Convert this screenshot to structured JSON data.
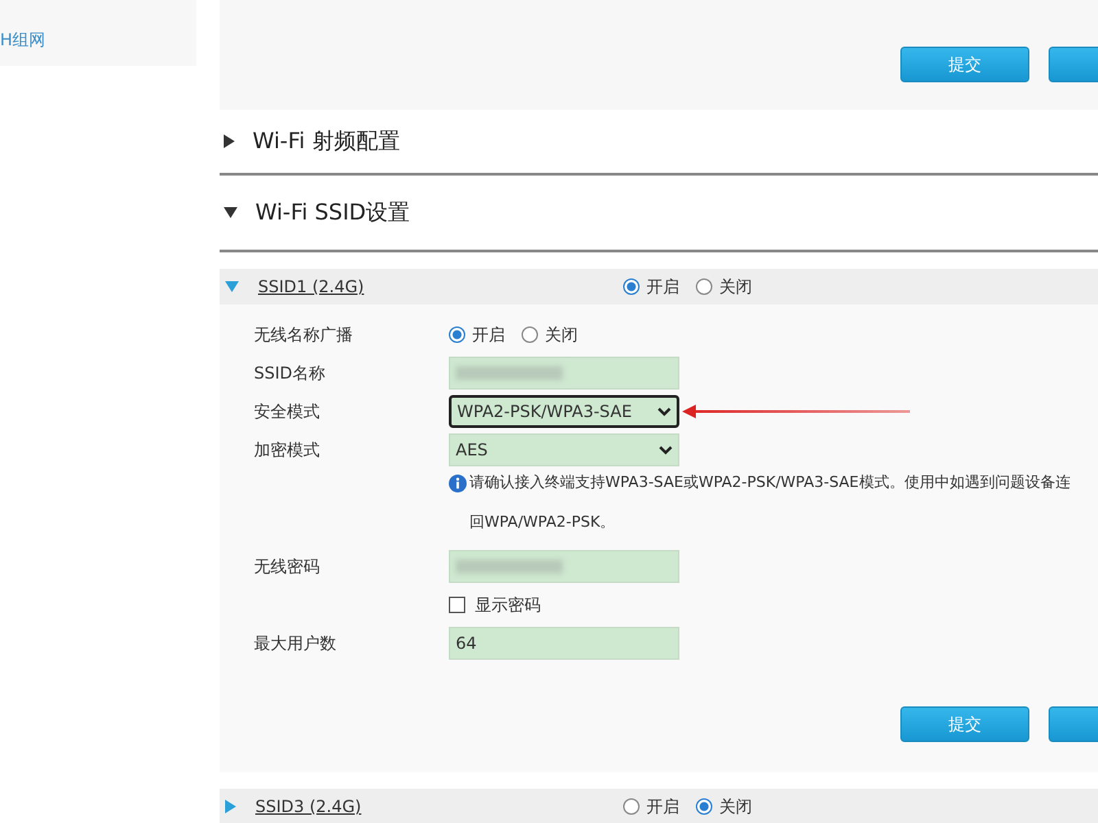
{
  "sidebar": {
    "items": [
      {
        "label": "H组网"
      }
    ]
  },
  "top_buttons": [
    {
      "kind": "submit",
      "label": "提交"
    },
    {
      "kind": "blank"
    }
  ],
  "sections": [
    {
      "title": "Wi-Fi 射频配置",
      "expanded": false
    },
    {
      "title": "Wi-Fi SSID设置",
      "expanded": true
    }
  ],
  "ssids": [
    {
      "name": "SSID1 (2.4G)",
      "expanded": true,
      "options": [
        {
          "label": "开启",
          "selected": true
        },
        {
          "label": "关闭",
          "selected": false
        }
      ],
      "fields": [
        {
          "kind": "radio",
          "label": "无线名称广播",
          "options": [
            {
              "label": "开启",
              "selected": true
            },
            {
              "label": "关闭",
              "selected": false
            }
          ]
        },
        {
          "kind": "masked",
          "label": "SSID名称"
        },
        {
          "kind": "select",
          "label": "安全模式",
          "value": "WPA2-PSK/WPA3-SAE",
          "highlighted": true
        },
        {
          "kind": "select",
          "label": "加密模式",
          "value": "AES",
          "highlighted": false
        },
        {
          "kind": "notice",
          "lines": [
            "请确认接入终端支持WPA3-SAE或WPA2-PSK/WPA3-SAE模式。使用中如遇到问题设备连",
            "回WPA/WPA2-PSK。"
          ]
        },
        {
          "kind": "masked",
          "label": "无线密码"
        },
        {
          "kind": "checkbox",
          "label": "显示密码",
          "checked": false
        },
        {
          "kind": "text",
          "label": "最大用户数",
          "value": "64"
        }
      ],
      "buttons": [
        {
          "kind": "submit",
          "label": "提交"
        },
        {
          "kind": "blank"
        }
      ]
    },
    {
      "name": "SSID3 (2.4G)",
      "expanded": false,
      "options": [
        {
          "label": "开启",
          "selected": false
        },
        {
          "label": "关闭",
          "selected": true
        }
      ]
    }
  ]
}
